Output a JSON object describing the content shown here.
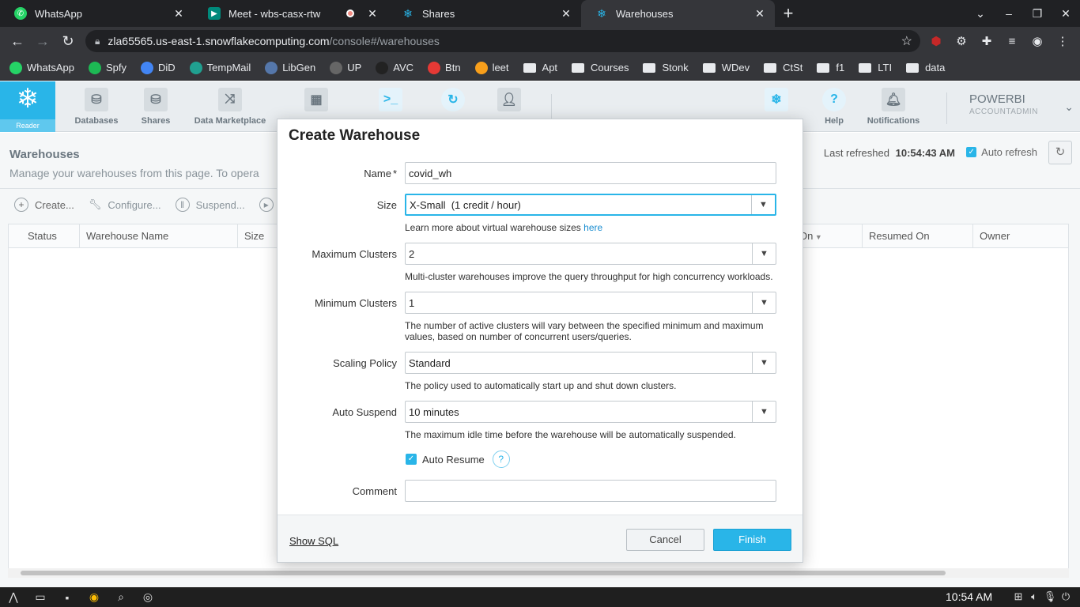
{
  "browser": {
    "tabs": [
      {
        "title": "WhatsApp",
        "favicon_color": "#25d366",
        "active": false
      },
      {
        "title": "Meet - wbs-casx-rtw",
        "favicon_color": "#00897b",
        "active": false
      },
      {
        "title": "Shares",
        "favicon_color": "#29b5e8",
        "active": false
      },
      {
        "title": "Warehouses",
        "favicon_color": "#29b5e8",
        "active": true
      }
    ],
    "url_host": "zla65565.us-east-1.snowflakecomputing.com",
    "url_path": "/console#/warehouses",
    "bookmarks": [
      {
        "label": "WhatsApp",
        "type": "site",
        "color": "#25d366"
      },
      {
        "label": "Spfy",
        "type": "site",
        "color": "#1db954"
      },
      {
        "label": "DiD",
        "type": "site",
        "color": "#4285f4"
      },
      {
        "label": "TempMail",
        "type": "site",
        "color": "#20a090"
      },
      {
        "label": "LibGen",
        "type": "site",
        "color": "#5577aa"
      },
      {
        "label": "UP",
        "type": "site",
        "color": "#666666"
      },
      {
        "label": "AVC",
        "type": "site",
        "color": "#222222"
      },
      {
        "label": "Btn",
        "type": "site",
        "color": "#e53935"
      },
      {
        "label": "leet",
        "type": "site",
        "color": "#f89f1b"
      },
      {
        "label": "Apt",
        "type": "folder"
      },
      {
        "label": "Courses",
        "type": "folder"
      },
      {
        "label": "Stonk",
        "type": "folder"
      },
      {
        "label": "WDev",
        "type": "folder"
      },
      {
        "label": "CtSt",
        "type": "folder"
      },
      {
        "label": "f1",
        "type": "folder"
      },
      {
        "label": "LTI",
        "type": "folder"
      },
      {
        "label": "data",
        "type": "folder"
      }
    ]
  },
  "app": {
    "logo_label": "Reader",
    "nav": [
      {
        "label": "Databases",
        "icon": "database-icon"
      },
      {
        "label": "Shares",
        "icon": "shares-icon"
      },
      {
        "label": "Data Marketplace",
        "icon": "marketplace-icon"
      },
      {
        "label": "",
        "icon": "warehouses-icon"
      },
      {
        "label": "",
        "icon": "worksheets-icon"
      },
      {
        "label": "",
        "icon": "history-icon"
      },
      {
        "label": "",
        "icon": "account-icon"
      }
    ],
    "nav_right": [
      {
        "label": "",
        "icon": "partner-connect-icon"
      },
      {
        "label": "Help",
        "icon": "help-icon"
      },
      {
        "label": "Notifications",
        "icon": "bell-icon"
      }
    ],
    "account": {
      "user": "POWERBI",
      "role": "ACCOUNTADMIN"
    },
    "accent": "#29b5e8"
  },
  "page": {
    "title": "Warehouses",
    "subtitle": "Manage your warehouses from this page. To opera",
    "last_refreshed_label": "Last refreshed",
    "last_refreshed_time": "10:54:43 AM",
    "auto_refresh_label": "Auto refresh",
    "toolbar": [
      "Create...",
      "Configure...",
      "Suspend..."
    ],
    "columns": [
      "Status",
      "Warehouse Name",
      "Size",
      "On",
      "Resumed On",
      "Owner"
    ]
  },
  "dialog": {
    "title": "Create Warehouse",
    "name_label": "Name",
    "name_required": "*",
    "name_value": "covid_wh",
    "size_label": "Size",
    "size_value": "X-Small  (1 credit / hour)",
    "size_help": "Learn more about virtual warehouse sizes",
    "size_help_link": "here",
    "max_clusters_label": "Maximum Clusters",
    "max_clusters_value": "2",
    "max_clusters_help": "Multi-cluster warehouses improve the query throughput for high concurrency workloads.",
    "min_clusters_label": "Minimum Clusters",
    "min_clusters_value": "1",
    "min_clusters_help": "The number of active clusters will vary between the specified minimum and maximum values, based on number of concurrent users/queries.",
    "scaling_label": "Scaling Policy",
    "scaling_value": "Standard",
    "scaling_help": "The policy used to automatically start up and shut down clusters.",
    "suspend_label": "Auto Suspend",
    "suspend_value": "10 minutes",
    "suspend_help": "The maximum idle time before the warehouse will be automatically suspended.",
    "auto_resume_label": "Auto Resume",
    "auto_resume_checked": true,
    "comment_label": "Comment",
    "comment_value": "",
    "show_sql": "Show SQL",
    "cancel": "Cancel",
    "finish": "Finish"
  },
  "taskbar": {
    "clock": "10:54 AM"
  }
}
